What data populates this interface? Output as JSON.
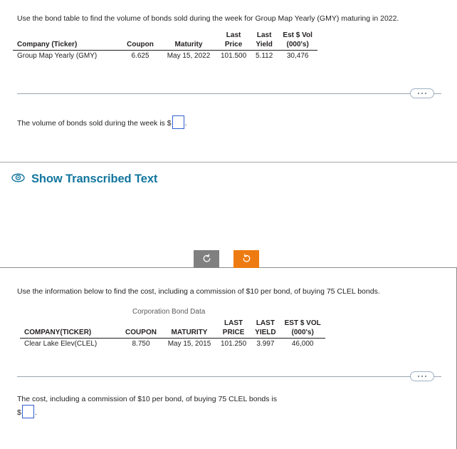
{
  "top_question": {
    "prompt": "Use the bond table to find the volume of bonds sold during the week for Group Map Yearly (GMY) maturing in 2022.",
    "table": {
      "headers": {
        "company": "Company (Ticker)",
        "coupon": "Coupon",
        "maturity": "Maturity",
        "last_price_line1": "Last",
        "last_price_line2": "Price",
        "last_yield_line1": "Last",
        "last_yield_line2": "Yield",
        "est_vol_line1": "Est $ Vol",
        "est_vol_line2": "(000's)"
      },
      "rows": [
        {
          "company": "Group Map Yearly (GMY)",
          "coupon": "6.625",
          "maturity": "May 15, 2022",
          "last_price": "101.500",
          "last_yield": "5.112",
          "est_vol": "30,476"
        }
      ]
    },
    "answer_prefix": "The volume of bonds sold during the week is $",
    "answer_value": "",
    "answer_suffix": "."
  },
  "transcribed_toggle": {
    "label": "Show Transcribed Text",
    "icon": "eye-icon",
    "color": "#12769e"
  },
  "nav_buttons": {
    "undo": {
      "label": "",
      "icon": "undo-circular-arrow-icon",
      "color": "#808080"
    },
    "redo": {
      "label": "",
      "icon": "redo-circular-arrow-icon",
      "color": "#ee7b11"
    }
  },
  "bottom_question": {
    "prompt": "Use the information below to find the cost, including a commission of $10 per bond, of buying 75 CLEL bonds.",
    "table_caption": "Corporation Bond Data",
    "table": {
      "headers": {
        "company": "COMPANY(TICKER)",
        "coupon": "COUPON",
        "maturity": "MATURITY",
        "last_price_line1": "LAST",
        "last_price_line2": "PRICE",
        "last_yield_line1": "LAST",
        "last_yield_line2": "YIELD",
        "est_vol_line1": "EST $ VOL",
        "est_vol_line2": "(000's)"
      },
      "rows": [
        {
          "company": "Clear Lake Elev(CLEL)",
          "coupon": "8.750",
          "maturity": "May 15, 2015",
          "last_price": "101.250",
          "last_yield": "3.997",
          "est_vol": "46,000"
        }
      ]
    },
    "answer_prefix": "The cost, including a commission of $10 per bond, of buying 75 CLEL bonds is",
    "answer_currency": "$",
    "answer_value": "",
    "answer_suffix": "."
  },
  "colors": {
    "link": "#12769e",
    "input_border": "#2f5fd0",
    "accent_orange": "#ee7b11",
    "gray_button": "#808080",
    "divider": "#9aa4b0"
  }
}
